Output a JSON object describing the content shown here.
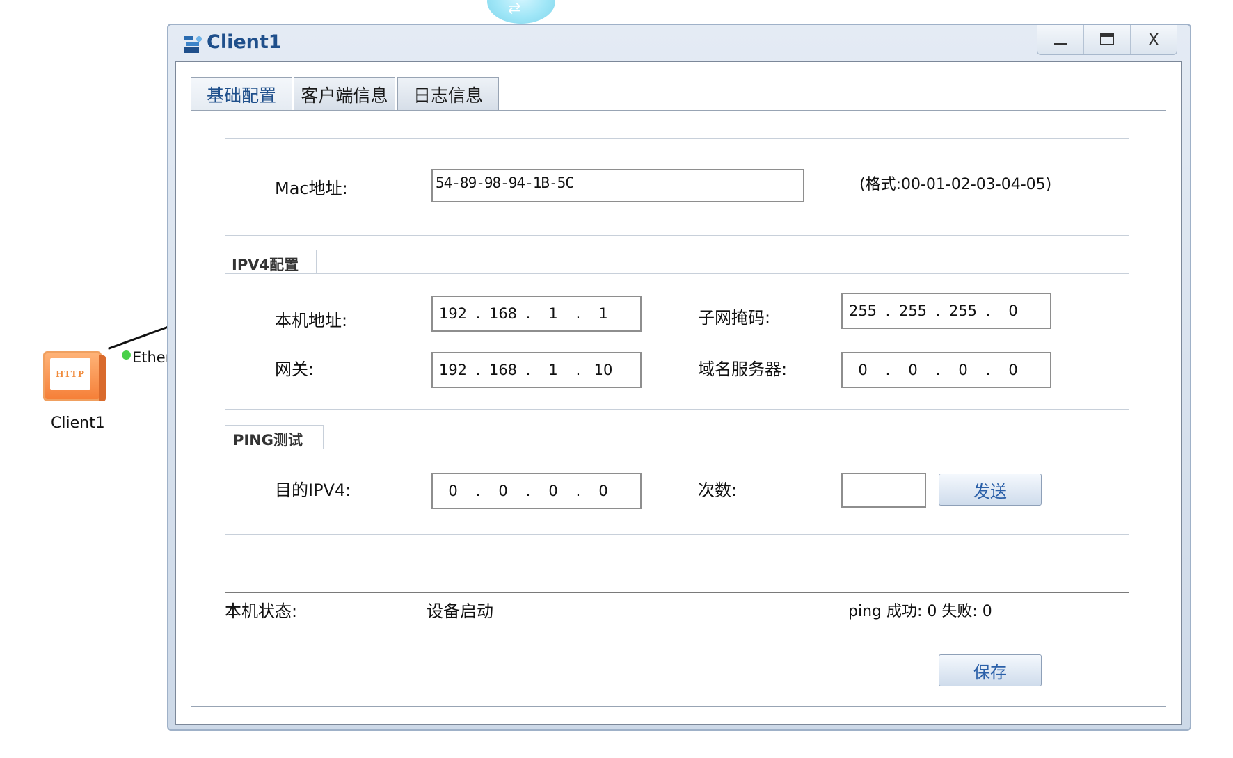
{
  "topology": {
    "device_label": "Client1",
    "device_screen": "HTTP",
    "port_label": "Ether"
  },
  "window": {
    "title": "Client1",
    "controls": {
      "minimize": "—",
      "maximize": "□",
      "close": "X"
    }
  },
  "tabs": [
    {
      "label": "基础配置",
      "active": true
    },
    {
      "label": "客户端信息",
      "active": false
    },
    {
      "label": "日志信息",
      "active": false
    }
  ],
  "mac": {
    "label": "Mac地址:",
    "value": "54-89-98-94-1B-5C",
    "hint": "(格式:00-01-02-03-04-05)"
  },
  "ipv4": {
    "legend": "IPV4配置",
    "local_label": "本机地址:",
    "local": [
      "192",
      "168",
      "1",
      "1"
    ],
    "mask_label": "子网掩码:",
    "mask": [
      "255",
      "255",
      "255",
      "0"
    ],
    "gateway_label": "网关:",
    "gateway": [
      "192",
      "168",
      "1",
      "10"
    ],
    "dns_label": "域名服务器:",
    "dns": [
      "0",
      "0",
      "0",
      "0"
    ]
  },
  "ping": {
    "legend": "PING测试",
    "dest_label": "目的IPV4:",
    "dest": [
      "0",
      "0",
      "0",
      "0"
    ],
    "count_label": "次数:",
    "count_value": "",
    "send_label": "发送"
  },
  "status": {
    "label": "本机状态:",
    "value": "设备启动",
    "ping_result": "ping 成功: 0 失败: 0"
  },
  "save_label": "保存"
}
